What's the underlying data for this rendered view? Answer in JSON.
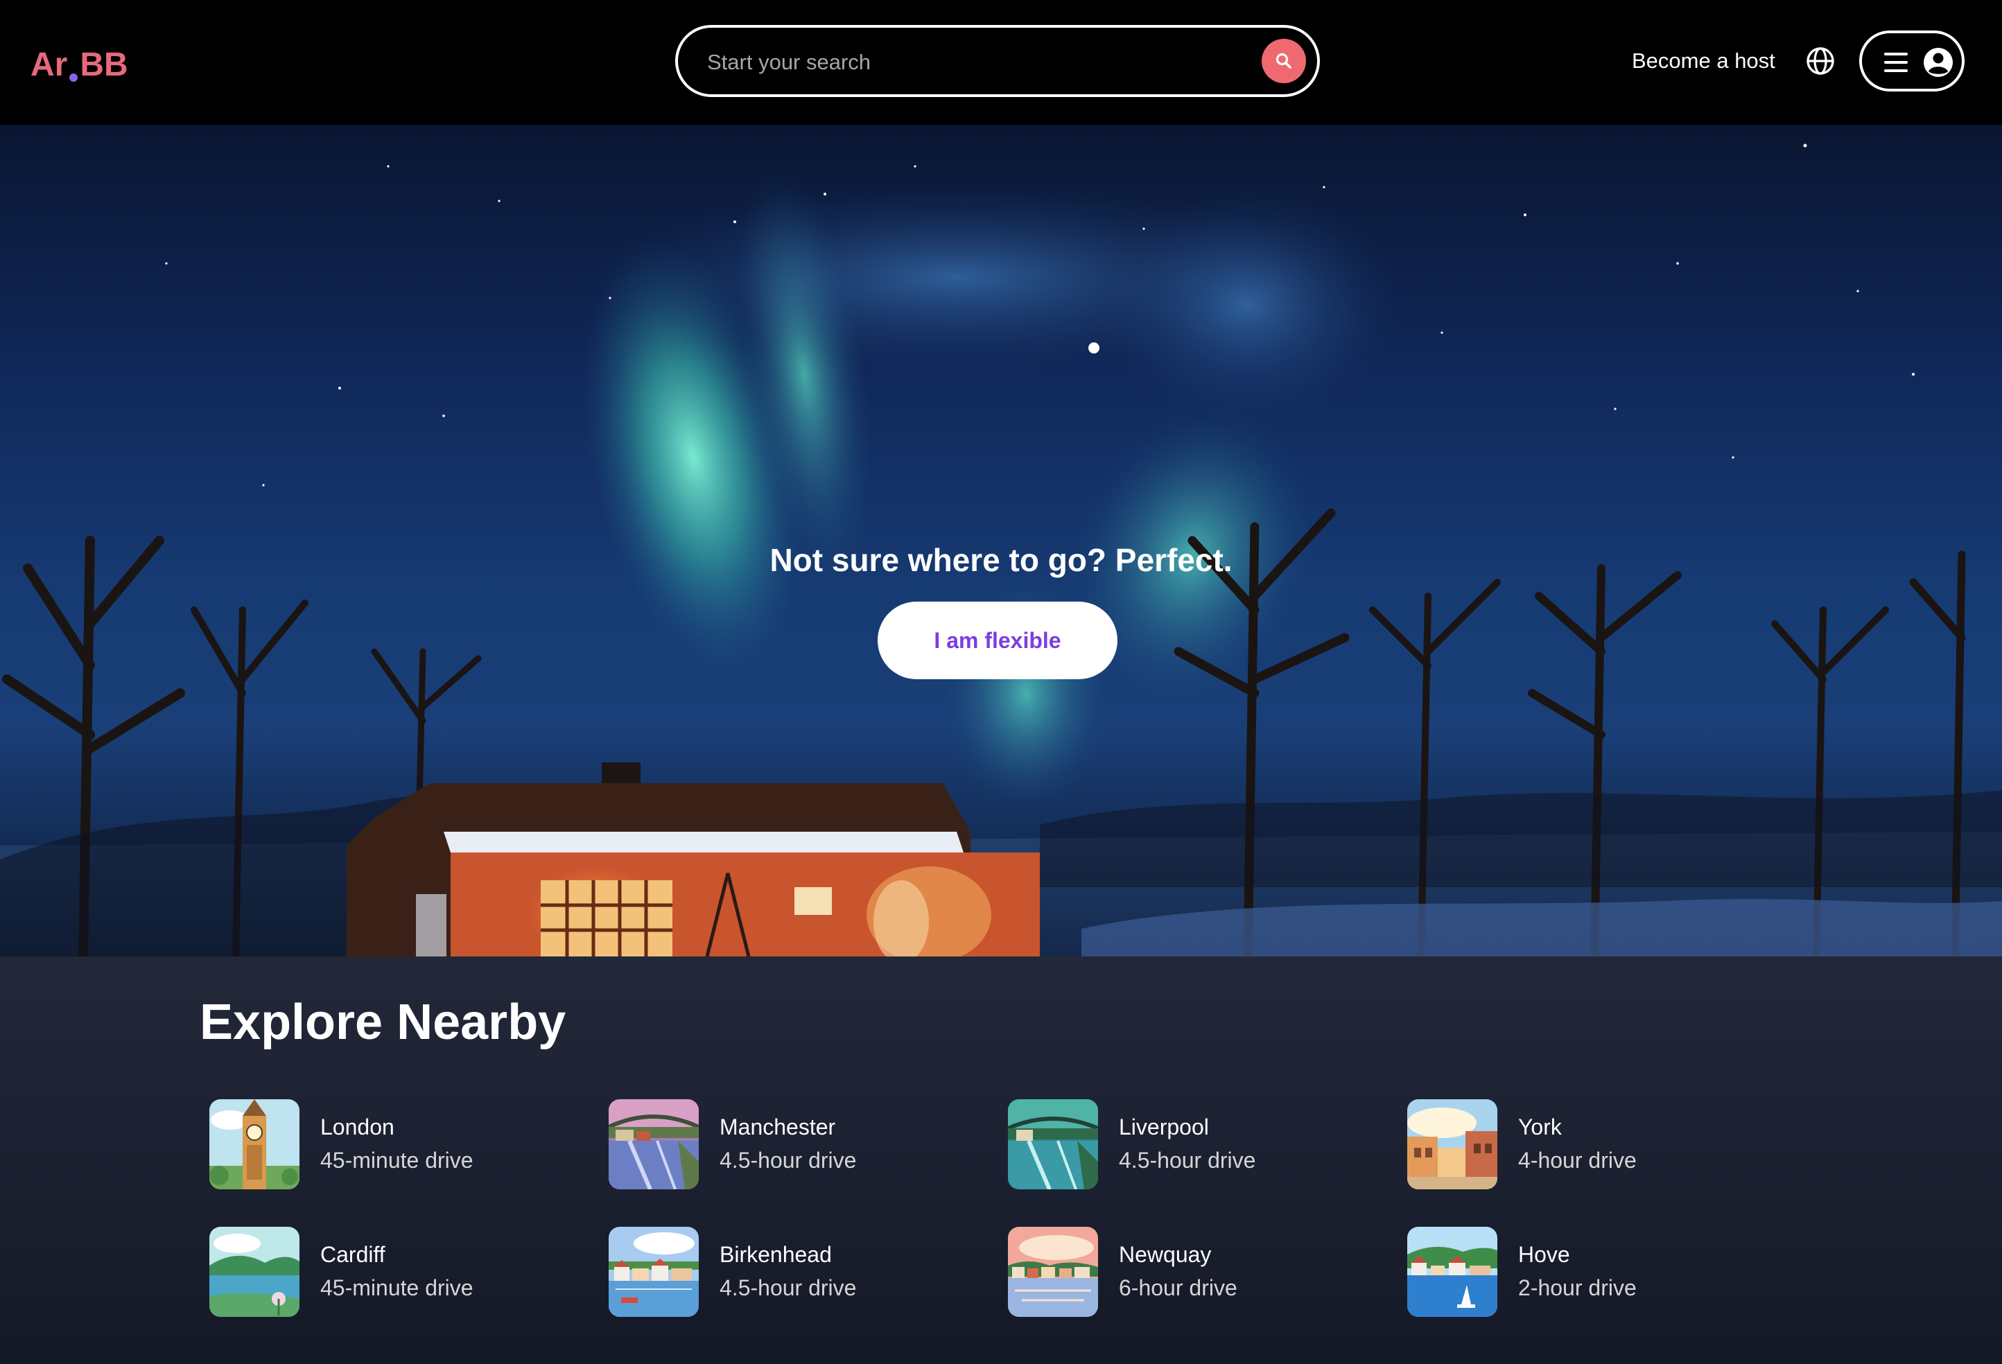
{
  "header": {
    "logo": {
      "left": "Ar",
      "right": "BB",
      "color": "#e66a7c",
      "dot_color": "#8a63e8"
    },
    "search": {
      "placeholder": "Start your search",
      "button_icon": "search-icon",
      "button_color": "#ef6a70"
    },
    "become_host": "Become a host",
    "globe_icon": "globe-icon",
    "menu": {
      "icons": [
        "hamburger-icon",
        "user-circle-icon"
      ]
    }
  },
  "hero": {
    "title": "Not sure where to go? Perfect.",
    "button_label": "I am flexible",
    "button_text_color": "#7b3ee0",
    "background": "aurora-night-cabin-photo"
  },
  "explore": {
    "title": "Explore Nearby",
    "places": [
      {
        "name": "London",
        "distance": "45-minute drive",
        "thumb": "big-ben-illustration"
      },
      {
        "name": "Manchester",
        "distance": "4.5-hour drive",
        "thumb": "bridge-river-illustration"
      },
      {
        "name": "Liverpool",
        "distance": "4.5-hour drive",
        "thumb": "bridge-canal-illustration"
      },
      {
        "name": "York",
        "distance": "4-hour drive",
        "thumb": "town-houses-illustration"
      },
      {
        "name": "Cardiff",
        "distance": "45-minute drive",
        "thumb": "lake-hills-illustration"
      },
      {
        "name": "Birkenhead",
        "distance": "4.5-hour drive",
        "thumb": "harbor-village-illustration"
      },
      {
        "name": "Newquay",
        "distance": "6-hour drive",
        "thumb": "sunset-coast-illustration"
      },
      {
        "name": "Hove",
        "distance": "2-hour drive",
        "thumb": "seaside-town-illustration"
      }
    ]
  }
}
